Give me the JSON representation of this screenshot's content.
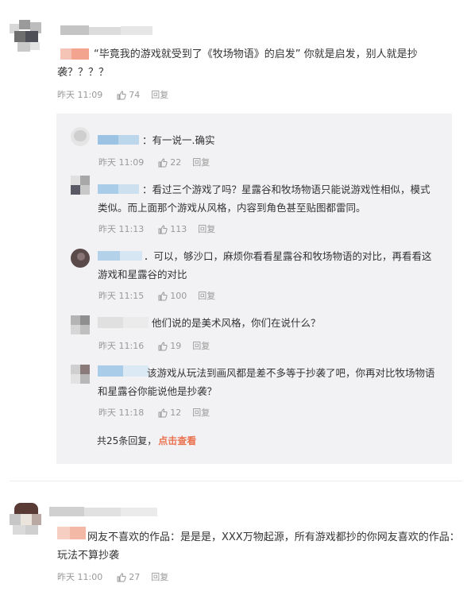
{
  "comments": [
    {
      "text_line1": "“毕竟我的游戏就受到了《牧场物语》的启发” 你就是启发，别人就是抄",
      "text_line2": "袭？？？？",
      "time": "昨天 11:09",
      "likes": "74",
      "reply": "回复"
    },
    {
      "text_line1": "网友不喜欢的作品：是是是，XXX万物起源，所有游戏都抄的你网友喜欢的作品：",
      "text_line2": "玩法不算抄袭",
      "time": "昨天 11:00",
      "likes": "27",
      "reply": "回复"
    }
  ],
  "replies": [
    {
      "text_line1": "：有一说一.确实",
      "text_line2": "",
      "time": "昨天 11:09",
      "likes": "22",
      "reply": "回复"
    },
    {
      "text_line1": "：看过三个游戏了吗？星露谷和牧场物语只能说游戏性相似，模式",
      "text_line2": "类似。而上面那个游戏从风格，内容到角色甚至贴图都雷同。",
      "time": "昨天 11:13",
      "likes": "113",
      "reply": "回复"
    },
    {
      "text_line1": "．可以，够沙口，麻烦你看看星露谷和牧场物语的对比，再看看这",
      "text_line2": "游戏和星露谷的对比",
      "time": "昨天 11:15",
      "likes": "100",
      "reply": "回复"
    },
    {
      "text_line1": "他们说的是美术风格，你们在说什么？",
      "text_line2": "",
      "time": "昨天 11:16",
      "likes": "19",
      "reply": "回复"
    },
    {
      "text_line1": "该游戏从玩法到画风都是差不多等于抄袭了吧，你再对比牧场物语",
      "text_line2": "和星露谷你能说他是抄袭？",
      "time": "昨天 11:18",
      "likes": "12",
      "reply": "回复"
    }
  ],
  "more_replies": {
    "count_text": "共25条回复，",
    "link_text": "点击查看"
  },
  "colors": {
    "link": "#eb7350",
    "thread_bg": "#f2f2f5",
    "meta": "#999999",
    "text": "#333333"
  },
  "icons": {
    "like": "thumbs-up-icon"
  }
}
